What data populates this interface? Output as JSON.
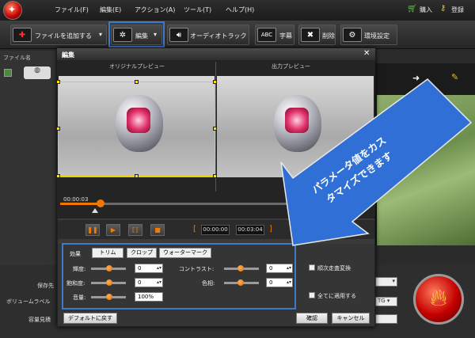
{
  "menu": {
    "items": [
      "ファイル(F)",
      "編集(E)",
      "アクション(A)",
      "ツール(T)",
      "ヘルプ(H)"
    ],
    "buy": "購入",
    "register": "登録"
  },
  "toolbar": {
    "add_file": "ファイルを追加する",
    "edit": "編集",
    "audio_track": "オーディオトラック",
    "subtitle": "字幕",
    "delete": "削除",
    "settings": "環境設定",
    "subtitle_icon_text": "ABC"
  },
  "background": {
    "file_name_header": "ファイル名",
    "save_to": "保存先",
    "volume_label": "ボリュームラベル",
    "capacity": "容量見積",
    "format_hint": "TG"
  },
  "dialog": {
    "title": "編集",
    "original_preview": "オリジナルプレビュー",
    "output_preview": "出力プレビュー",
    "current_time": "00:00:03",
    "start_time": "00:00:00",
    "end_time": "00:03:04",
    "tabs": [
      "効果",
      "トリム",
      "クロップ",
      "ウォーターマーク"
    ],
    "params": {
      "brightness": {
        "label": "輝度:",
        "value": "0"
      },
      "saturation": {
        "label": "飽和度:",
        "value": "0"
      },
      "volume": {
        "label": "音量:",
        "value": "100%"
      },
      "contrast": {
        "label": "コントラスト:",
        "value": "0"
      },
      "hue": {
        "label": "色相:",
        "value": "0"
      }
    },
    "deinterlace": "順次走査変換",
    "apply_all": "全てに適用する",
    "restore_default": "デフォルトに戻す",
    "ok": "確認",
    "cancel": "キャンセル"
  },
  "callout": {
    "line1": "パラメータ値をカス",
    "line2": "タマイズできます",
    "color": "#2f6fd6"
  },
  "colors": {
    "accent": "#f07800",
    "highlight": "#3f79c9"
  }
}
